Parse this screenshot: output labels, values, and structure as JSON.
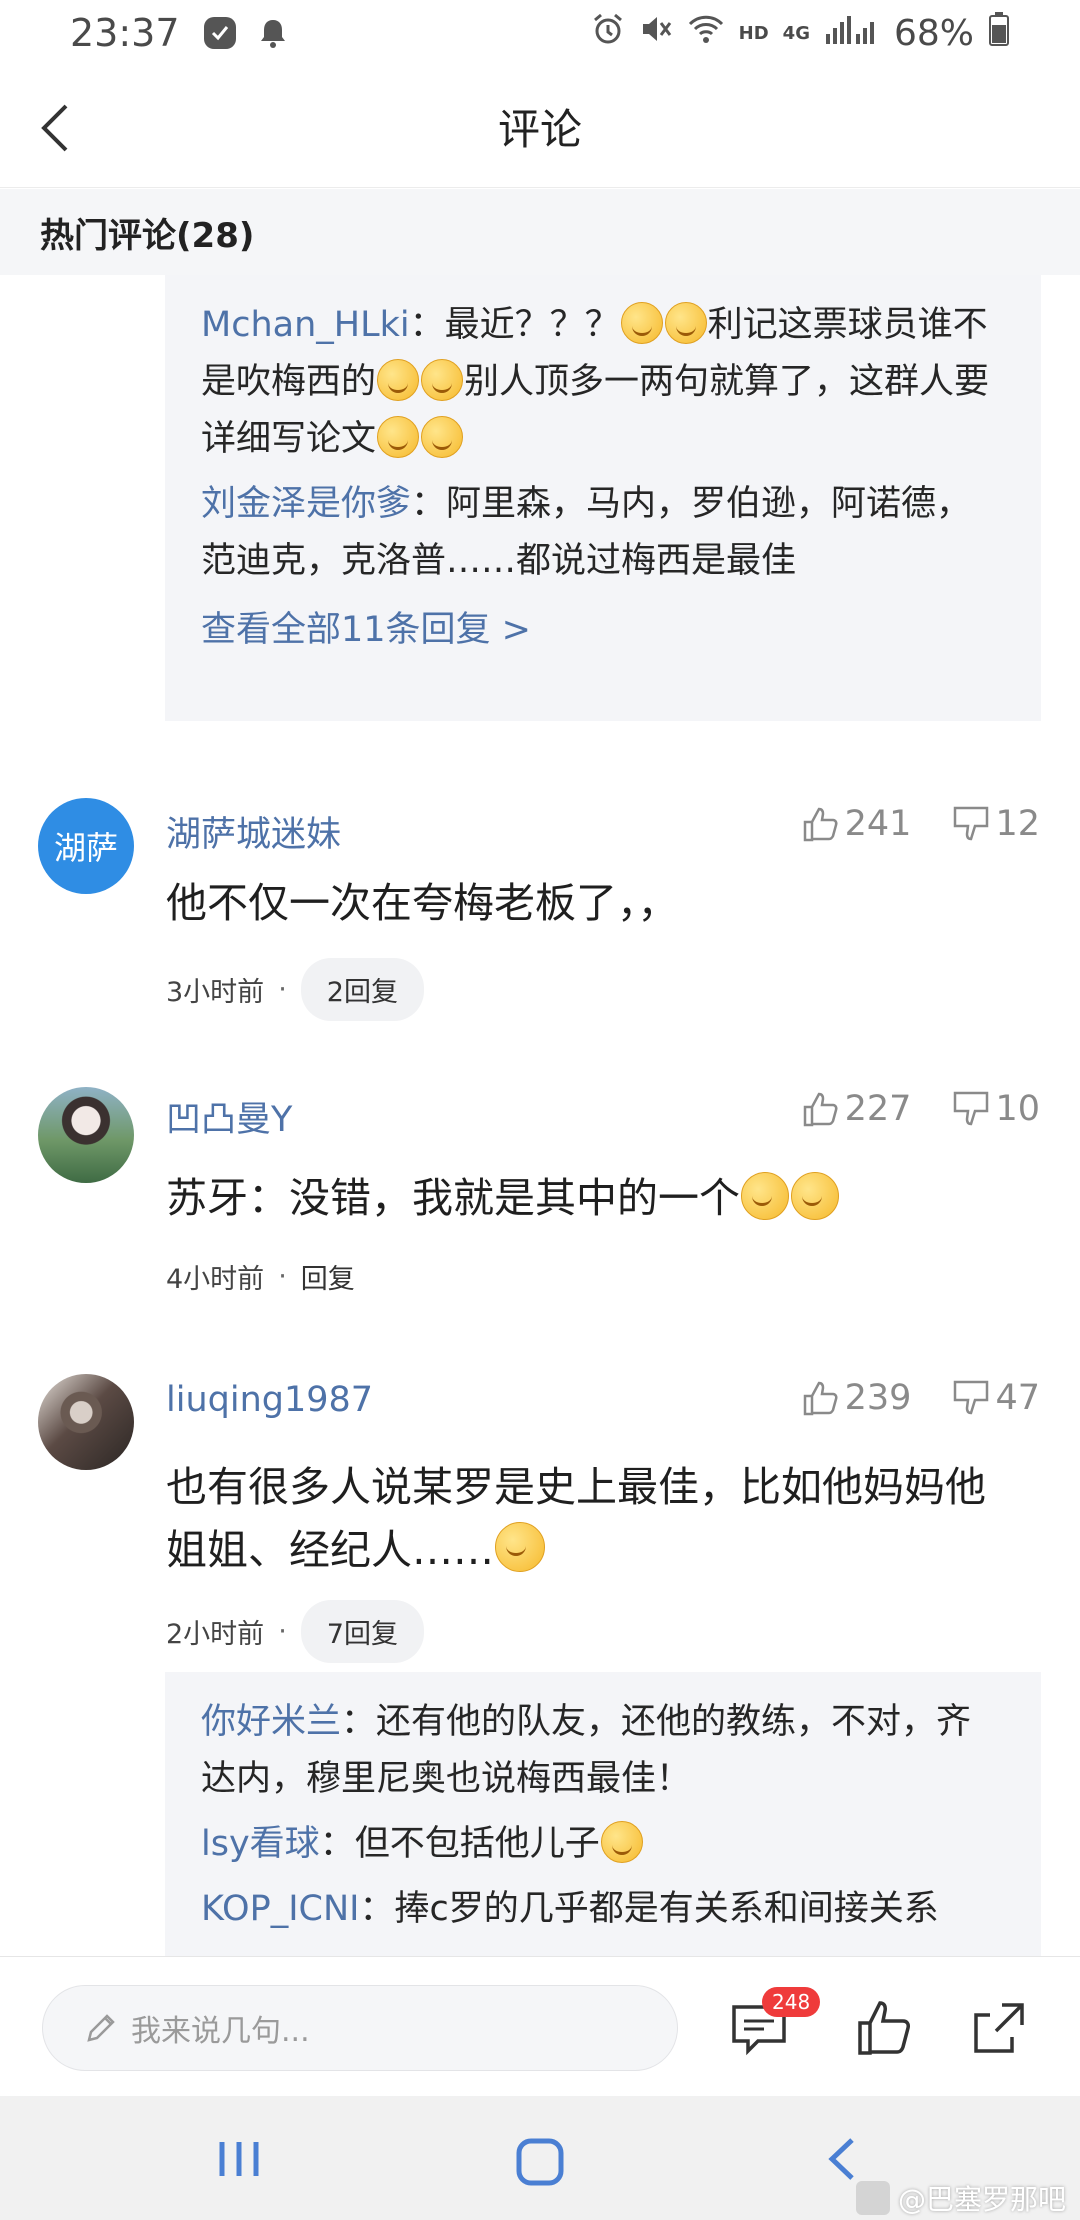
{
  "status": {
    "time": "23:37",
    "network": "HD",
    "signal_label": "4G",
    "battery": "68%"
  },
  "header": {
    "title": "评论"
  },
  "section": {
    "title": "热门评论(28)"
  },
  "top_replies": {
    "items": [
      {
        "user": "Mchan_HLki",
        "sep": "：",
        "text_a": "最近？？？",
        "text_b": "利记这票球员谁不是吹梅西的",
        "text_c": "别人顶多一两句就算了，这群人要详细写论文"
      },
      {
        "user": "刘金泽是你爹",
        "sep": "：",
        "text": "阿里森，马内，罗伯逊，阿诺德，范迪克，克洛普……都说过梅西是最佳"
      }
    ],
    "see_all": "查看全部11条回复 >"
  },
  "comments": [
    {
      "avatar_text": "湖萨",
      "name": "湖萨城迷妹",
      "likes": "241",
      "dislikes": "12",
      "text": "他不仅一次在夸梅老板了，，",
      "time": "3小时前",
      "dot": "·",
      "reply": "2回复"
    },
    {
      "name": "凹凸曼Y",
      "likes": "227",
      "dislikes": "10",
      "text": "苏牙：没错，我就是其中的一个",
      "time": "4小时前",
      "dot": "·",
      "reply": "回复"
    },
    {
      "name": "liuqing1987",
      "likes": "239",
      "dislikes": "47",
      "text_line1": "也有很多人说某罗是史上最佳，比如他妈妈他",
      "text_line2": "姐姐、经纪人……",
      "time": "2小时前",
      "dot": "·",
      "reply": "7回复"
    }
  ],
  "bottom_replies": {
    "items": [
      {
        "user": "你好米兰",
        "sep": "：",
        "text": "还有他的队友，还他的教练，不对，齐达内，穆里尼奥也说梅西最佳！"
      },
      {
        "user": "lsy看球",
        "sep": "：",
        "text": "但不包括他儿子"
      },
      {
        "user": "KOP_ICNI",
        "sep": "：",
        "text": "捧c罗的几乎都是有关系和间接关系"
      }
    ]
  },
  "bottom_bar": {
    "input_placeholder": "我来说几句...",
    "comment_count": "248"
  },
  "watermark": "@巴塞罗那吧",
  "colors": {
    "link": "#4e72a8",
    "badge": "#ef3b3b",
    "avatar_bg": "#2f8de4"
  }
}
